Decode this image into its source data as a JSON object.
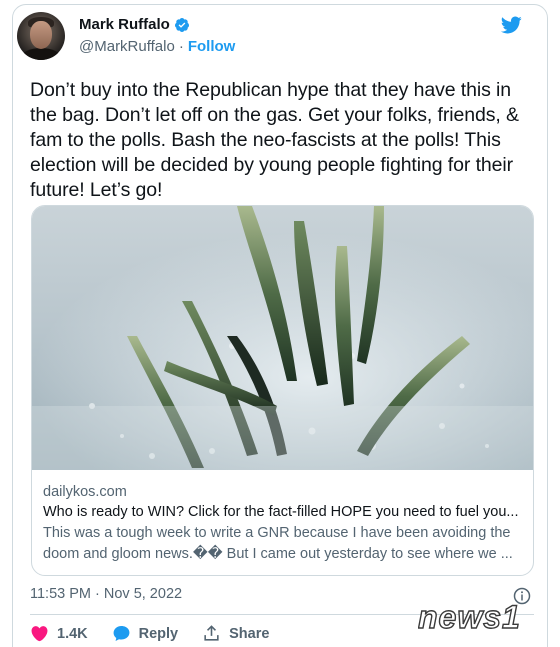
{
  "author": {
    "name": "Mark Ruffalo",
    "handle": "@MarkRuffalo",
    "follow_label": "Follow"
  },
  "tweet": {
    "text": "Don’t buy into the Republican hype that they have this in the bag. Don’t let off on the gas. Get your folks, friends, & fam to the polls. Bash the neo-fascists at the polls! This election will be decided by young people fighting for their future! Let’s go!",
    "timestamp": "11:53 PM · Nov 5, 2022"
  },
  "link_card": {
    "domain": "dailykos.com",
    "title": "Who is ready to WIN? Click for the fact-filled HOPE you need to fuel you...",
    "description": "This was a tough week to write a GNR because I have been avoiding the doom and gloom news.�� But I came out yesterday to see where we ..."
  },
  "actions": {
    "like_count": "1.4K",
    "reply_label": "Reply",
    "share_label": "Share"
  },
  "watermark": {
    "text": "news1"
  },
  "colors": {
    "brand_blue": "#1d9bf0",
    "like_pink": "#f91880",
    "secondary_text": "#536471"
  },
  "icons": [
    "verified-badge-icon",
    "twitter-bird-icon",
    "info-icon",
    "heart-icon",
    "reply-icon",
    "share-icon"
  ]
}
